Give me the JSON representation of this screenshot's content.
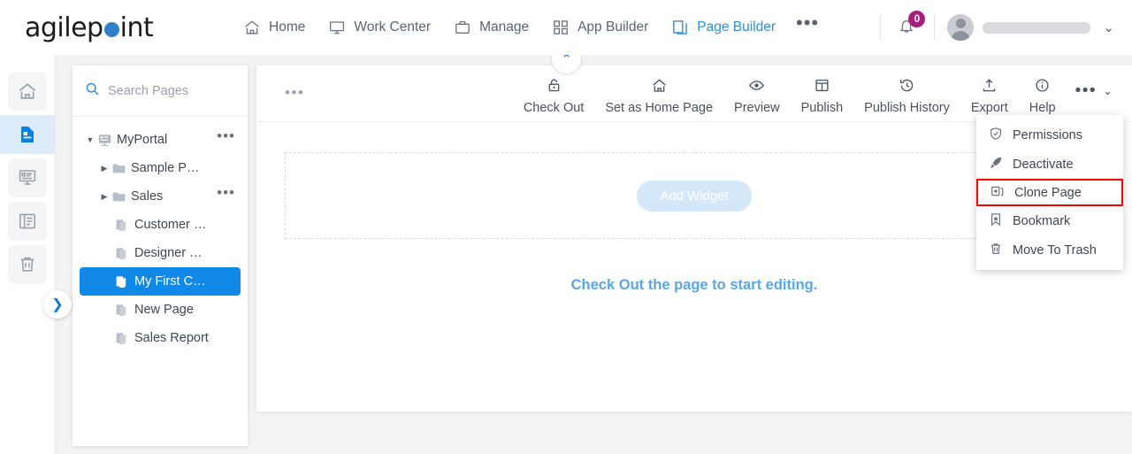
{
  "header": {
    "logo_text_pre": "agilep",
    "logo_text_post": "int",
    "logo_dot": "blue-dot",
    "nav": [
      {
        "label": "Home",
        "icon": "home-icon",
        "active": false
      },
      {
        "label": "Work Center",
        "icon": "monitor-icon",
        "active": false
      },
      {
        "label": "Manage",
        "icon": "briefcase-icon",
        "active": false
      },
      {
        "label": "App Builder",
        "icon": "grid-icon",
        "active": false
      },
      {
        "label": "Page Builder",
        "icon": "pages-icon",
        "active": true
      }
    ],
    "overflow": "•••",
    "notification_count": "0",
    "notification_icon": "bell-icon",
    "avatar_icon": "avatar",
    "username": "",
    "chevron": "⌄"
  },
  "rail": {
    "items": [
      {
        "icon": "home-icon",
        "name": "home",
        "active": false
      },
      {
        "icon": "page-icon",
        "name": "pages",
        "active": true
      },
      {
        "icon": "form-icon",
        "name": "forms",
        "active": false
      },
      {
        "icon": "layout-icon",
        "name": "layouts",
        "active": false
      },
      {
        "icon": "trash-icon",
        "name": "trash",
        "active": false
      }
    ],
    "expander": "❯"
  },
  "tree_panel": {
    "search_placeholder": "Search Pages",
    "search_icon": "search-icon",
    "nodes": [
      {
        "label": "MyPortal",
        "icon": "portal-icon",
        "tri": "▼",
        "indent": 0,
        "dots": true,
        "selected": false
      },
      {
        "label": "Sample P…",
        "icon": "folder-icon",
        "tri": "▶",
        "indent": 1,
        "dots": false,
        "selected": false
      },
      {
        "label": "Sales",
        "icon": "folder-icon",
        "tri": "▶",
        "indent": 1,
        "dots": true,
        "selected": false
      },
      {
        "label": "Customer …",
        "icon": "page-icon",
        "tri": "",
        "indent": 2,
        "dots": false,
        "selected": false
      },
      {
        "label": "Designer …",
        "icon": "page-icon",
        "tri": "",
        "indent": 2,
        "dots": false,
        "selected": false
      },
      {
        "label": "My First C…",
        "icon": "page-icon",
        "tri": "",
        "indent": 2,
        "dots": false,
        "selected": true
      },
      {
        "label": "New Page",
        "icon": "page-icon",
        "tri": "",
        "indent": 2,
        "dots": false,
        "selected": false
      },
      {
        "label": "Sales Report",
        "icon": "page-icon",
        "tri": "",
        "indent": 2,
        "dots": false,
        "selected": false
      }
    ],
    "dots": "•••"
  },
  "toolbar": {
    "left_dots": "•••",
    "collapse_chevron": "⌃",
    "items": [
      {
        "label": "Check Out",
        "icon": "lock-icon"
      },
      {
        "label": "Set as Home Page",
        "icon": "home-icon"
      },
      {
        "label": "Preview",
        "icon": "eye-icon"
      },
      {
        "label": "Publish",
        "icon": "publish-icon"
      },
      {
        "label": "Publish History",
        "icon": "history-icon"
      },
      {
        "label": "Export",
        "icon": "export-icon"
      },
      {
        "label": "Help",
        "icon": "info-icon"
      }
    ],
    "more_dots": "•••",
    "more_chevron": "⌄"
  },
  "canvas": {
    "add_widget_label": "Add Widget",
    "hint": "Check Out the page to start editing."
  },
  "menu": {
    "items": [
      {
        "label": "Permissions",
        "icon": "shield-check-icon",
        "highlighted": false
      },
      {
        "label": "Deactivate",
        "icon": "deactivate-icon",
        "highlighted": false
      },
      {
        "label": "Clone Page",
        "icon": "clone-icon",
        "highlighted": true
      },
      {
        "label": "Bookmark",
        "icon": "bookmark-icon",
        "highlighted": false
      },
      {
        "label": "Move To Trash",
        "icon": "trash-icon",
        "highlighted": false
      }
    ]
  },
  "colors": {
    "brand_blue": "#2f80c8",
    "accent_blue": "#1089e8",
    "badge_magenta": "#a51e7d",
    "highlight_red": "#ff0000",
    "hint_blue": "#5aa6e8"
  }
}
